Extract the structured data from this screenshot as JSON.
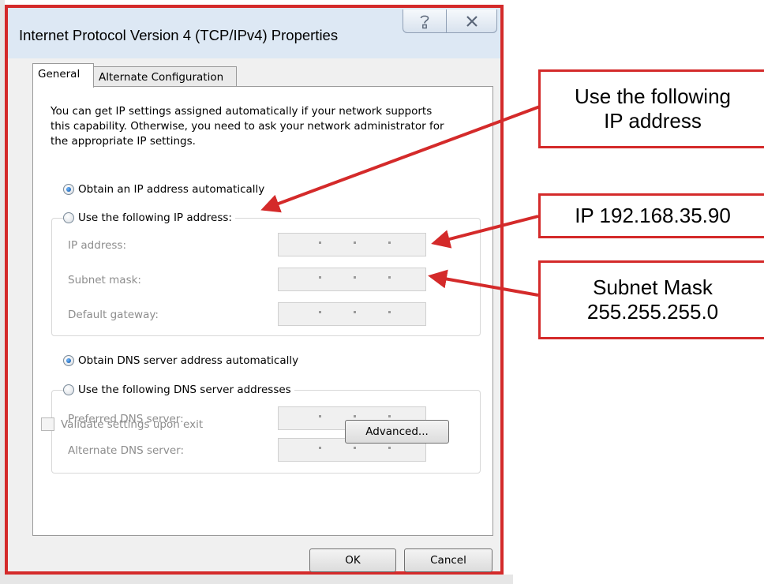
{
  "window": {
    "title": "Internet Protocol Version 4 (TCP/IPv4) Properties",
    "help_icon": "help-question-icon",
    "close_icon": "close-x-icon"
  },
  "tabs": [
    {
      "label": "General",
      "selected": true
    },
    {
      "label": "Alternate Configuration",
      "selected": false
    }
  ],
  "general": {
    "intro": "You can get IP settings assigned automatically if your network supports this capability. Otherwise, you need to ask your network administrator for the appropriate IP settings.",
    "ip_mode": {
      "auto_label": "Obtain an IP address automatically",
      "manual_label": "Use the following IP address:",
      "selected": "auto"
    },
    "ip_fields": [
      {
        "label": "IP address:",
        "value": ". . ."
      },
      {
        "label": "Subnet mask:",
        "value": ". . ."
      },
      {
        "label": "Default gateway:",
        "value": ". . ."
      }
    ],
    "dns_mode": {
      "auto_label": "Obtain DNS server address automatically",
      "manual_label": "Use the following DNS server addresses",
      "selected": "auto"
    },
    "dns_fields": [
      {
        "label": "Preferred DNS server:",
        "value": ". . ."
      },
      {
        "label": "Alternate DNS server:",
        "value": ". . ."
      }
    ],
    "validate_label": "Validate settings upon exit",
    "validate_checked": false,
    "advanced_label": "Advanced..."
  },
  "footer": {
    "ok_label": "OK",
    "cancel_label": "Cancel"
  },
  "callouts": {
    "c1_line1": "Use the following",
    "c1_line2": "IP address",
    "c2": "IP 192.168.35.90",
    "c3_line1": "Subnet Mask",
    "c3_line2": "255.255.255.0"
  },
  "colors": {
    "annotation_red": "#d42a2a",
    "titlebar": "#dde8f4",
    "dialog_bg": "#f0f0f0"
  }
}
